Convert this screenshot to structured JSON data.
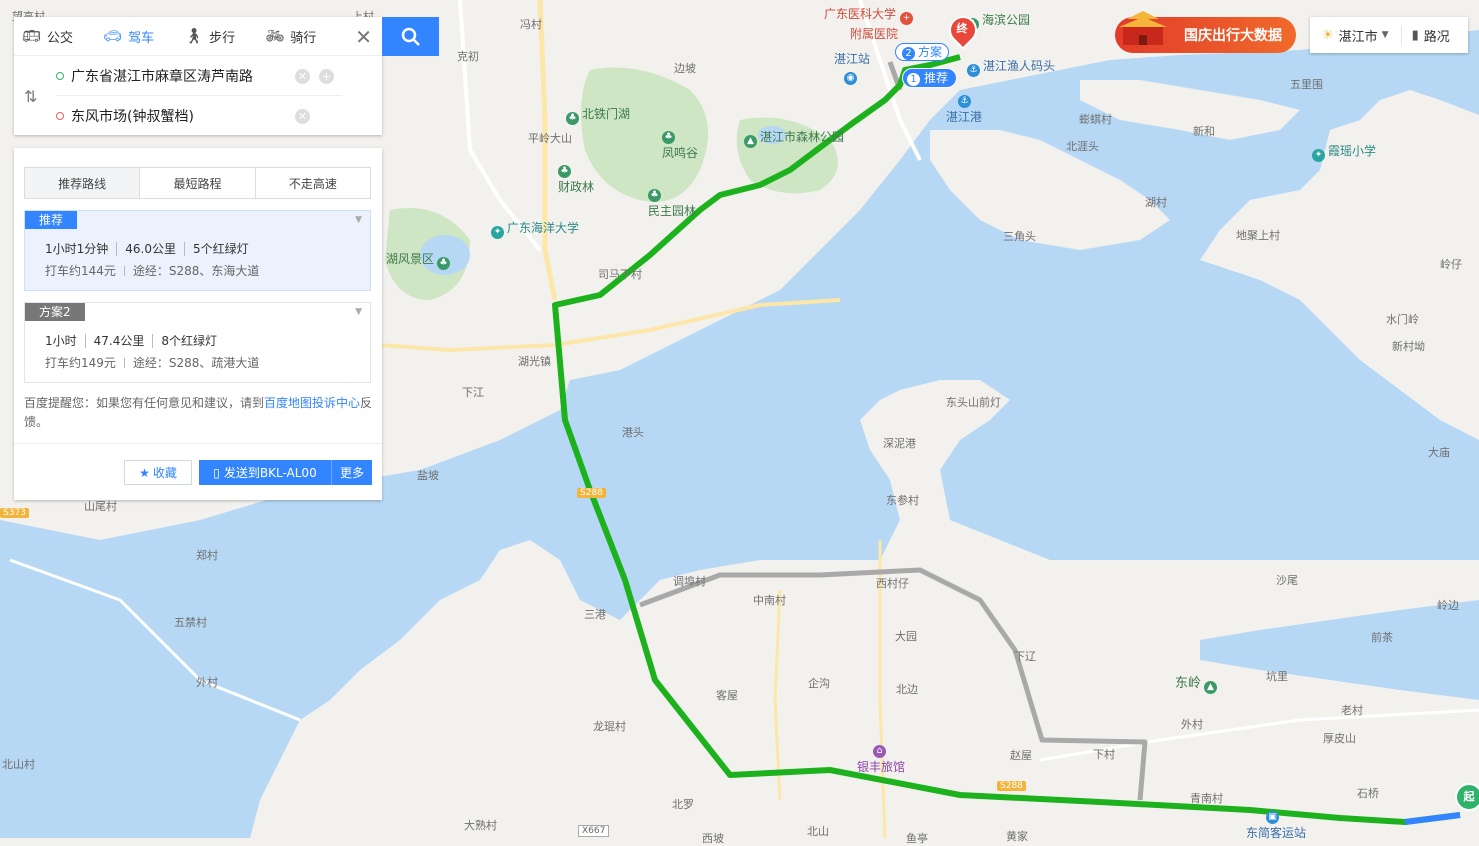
{
  "search": {
    "modes": [
      {
        "label": "公交",
        "icon": "bus-icon"
      },
      {
        "label": "驾车",
        "icon": "car-icon"
      },
      {
        "label": "步行",
        "icon": "walk-icon"
      },
      {
        "label": "骑行",
        "icon": "bike-icon"
      }
    ],
    "active_mode": "驾车",
    "start": "广东省湛江市麻章区涛芦南路",
    "end": "东风市场(钟叔蟹档)"
  },
  "results": {
    "tabs": [
      "推荐路线",
      "最短路程",
      "不走高速"
    ],
    "active_tab": "推荐路线",
    "routes": [
      {
        "tag": "推荐",
        "time": "1小时1分钟",
        "distance": "46.0公里",
        "lights": "5个红绿灯",
        "taxi": "打车约144元",
        "via": "途经：S288、东海大道"
      },
      {
        "tag": "方案2",
        "time": "1小时",
        "distance": "47.4公里",
        "lights": "8个红绿灯",
        "taxi": "打车约149元",
        "via": "途经：S288、疏港大道"
      }
    ],
    "notice_pre": "百度提醒您：如果您有任何意见和建议，请到",
    "notice_link": "百度地图投诉中心",
    "notice_post": "反馈。",
    "fav_label": "收藏",
    "send_label": "发送到BKL-AL00",
    "more_label": "更多"
  },
  "topright": {
    "banner": "国庆出行大数据",
    "city": "湛江市",
    "traffic": "路况"
  },
  "map": {
    "markers": {
      "recommend": "推荐",
      "plan2": "方案",
      "end": "终",
      "start": "起",
      "one": "1",
      "two": "2"
    },
    "labels": {
      "l1": "冯村",
      "l2": "克初",
      "l3": "边坡",
      "l4": "北铁门湖",
      "l5": "平岭大山",
      "l6": "凤鸣谷",
      "l7": "湛江市森林公园",
      "l8": "财政林",
      "l9": "民主园林",
      "l10": "广东海洋大学",
      "l11": "湖风景区",
      "l12": "司马下村",
      "l13": "湖光镇",
      "l14": "下江",
      "l15": "港头",
      "l16": "盐坡",
      "l17": "山尾村",
      "l18": "郑村",
      "l19": "五禁村",
      "l20": "外村",
      "l21": "北山村",
      "l22": "大熟村",
      "l23": "龙琨村",
      "l24": "客屋",
      "l25": "企沟",
      "l26": "北边",
      "l27": "大园",
      "l28": "中南村",
      "l29": "调埠村",
      "l30": "西村仔",
      "l31": "三港",
      "l32": "银丰旅馆",
      "l33": "北罗",
      "l34": "北山",
      "l35": "西坡",
      "l36": "鱼亭",
      "l37": "黄家",
      "l38": "下村",
      "l39": "赵屋",
      "l40": "青南村",
      "l41": "东简客运站",
      "l42": "下辽",
      "l43": "东岭",
      "l44": "坑里",
      "l45": "外村",
      "l46": "老村",
      "l47": "厚皮山",
      "l48": "石桥",
      "l49": "沙尾",
      "l50": "前茶",
      "l51": "岭边",
      "l52": "东参村",
      "l53": "深泥港",
      "l54": "东头山前灯",
      "l55": "三角头",
      "l56": "北涯头",
      "l57": "湖村",
      "l58": "地聚上村",
      "l59": "岭仔",
      "l60": "水门岭",
      "l61": "新村坳",
      "l62": "大庙",
      "l63": "五里围",
      "l64": "新和",
      "l65": "霞瑶小学",
      "l66": "蟛蜞村",
      "l67": "湛江港",
      "l68": "湛江渔人码头",
      "l69": "海滨公园",
      "l70": "广东医科大学",
      "l71": "附属医院",
      "l72": "湛江站",
      "l73": "望高村",
      "l74": "上村"
    },
    "road_shields": {
      "s288a": "S288",
      "s288b": "S288",
      "s373": "S373",
      "x667": "X667"
    },
    "colors": {
      "water": "#b6d8f5",
      "land": "#f2f1ee",
      "green": "#cfe6c4",
      "route_main": "#1db21d",
      "route_alt": "#a9a9a9",
      "accent": "#3385ff"
    }
  }
}
